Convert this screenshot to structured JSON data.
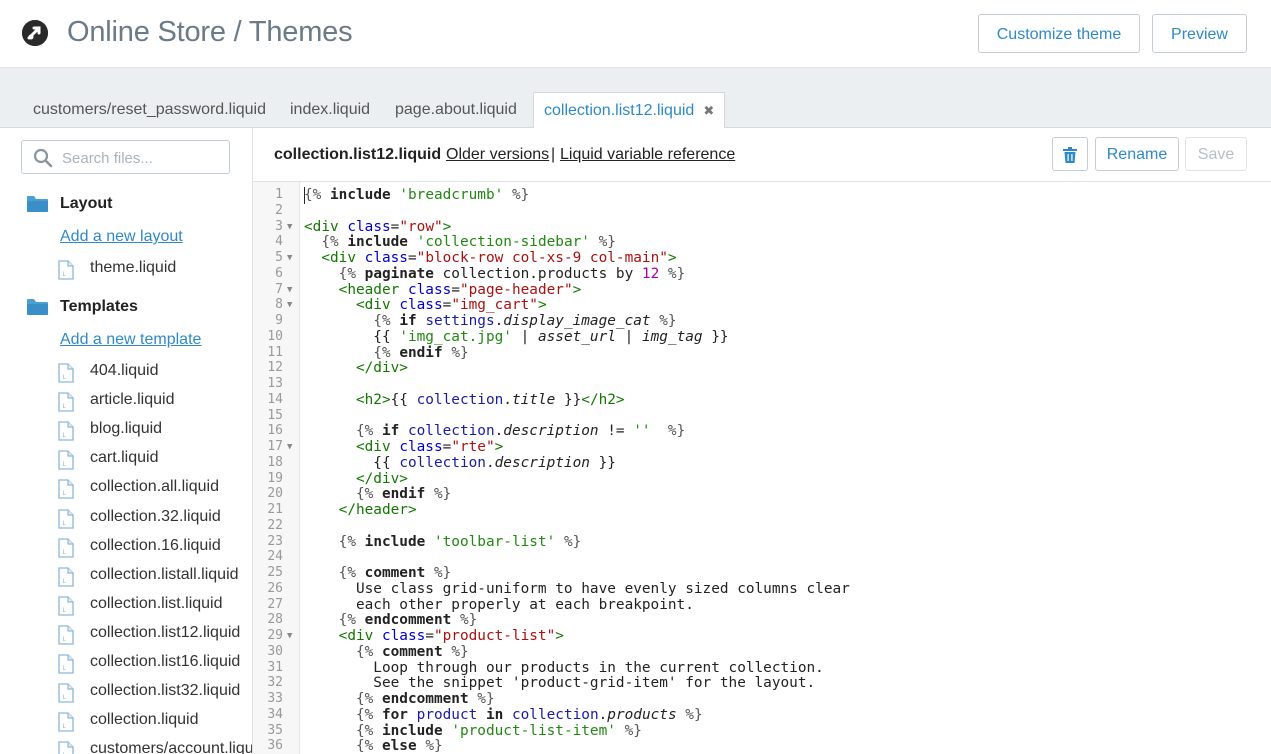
{
  "header": {
    "title": "Online Store / Themes",
    "customize_label": "Customize theme",
    "preview_label": "Preview"
  },
  "tabs": [
    {
      "label": "customers/reset_password.liquid",
      "active": false
    },
    {
      "label": "index.liquid",
      "active": false
    },
    {
      "label": "page.about.liquid",
      "active": false
    },
    {
      "label": "collection.list12.liquid",
      "active": true
    }
  ],
  "sidebar": {
    "search_placeholder": "Search files...",
    "layout_heading": "Layout",
    "add_layout_label": "Add a new layout",
    "layout_files": [
      "theme.liquid"
    ],
    "templates_heading": "Templates",
    "add_template_label": "Add a new template",
    "template_files": [
      "404.liquid",
      "article.liquid",
      "blog.liquid",
      "cart.liquid",
      "collection.all.liquid",
      "collection.32.liquid",
      "collection.16.liquid",
      "collection.listall.liquid",
      "collection.list.liquid",
      "collection.list12.liquid",
      "collection.list16.liquid",
      "collection.list32.liquid",
      "collection.liquid",
      "customers/account.liquid"
    ]
  },
  "editor": {
    "file_name": "collection.list12.liquid",
    "older_versions_label": "Older versions",
    "separator": "|",
    "variable_reference_label": "Liquid variable reference",
    "rename_label": "Rename",
    "save_label": "Save"
  },
  "colors": {
    "accent": "#2e8ac7",
    "tag": "#117700",
    "string": "#228811",
    "attr": "#0000cc",
    "variable": "#1a1aa6",
    "number": "#aa00aa"
  },
  "code_lines": [
    {
      "n": "1",
      "fold": false,
      "segs": [
        [
          "delim",
          "{% "
        ],
        [
          "kw",
          "include"
        ],
        [
          "p",
          " "
        ],
        [
          "str",
          "'breadcrumb'"
        ],
        [
          "p",
          " "
        ],
        [
          "delim",
          "%}"
        ]
      ]
    },
    {
      "n": "2",
      "fold": false,
      "segs": []
    },
    {
      "n": "3",
      "fold": true,
      "segs": [
        [
          "tag",
          "<div"
        ],
        [
          "p",
          " "
        ],
        [
          "attr",
          "class"
        ],
        [
          "p",
          "="
        ],
        [
          "aval",
          "\"row\""
        ],
        [
          "tag",
          ">"
        ]
      ]
    },
    {
      "n": "4",
      "fold": false,
      "segs": [
        [
          "p",
          "  "
        ],
        [
          "delim",
          "{% "
        ],
        [
          "kw",
          "include"
        ],
        [
          "p",
          " "
        ],
        [
          "str",
          "'collection-sidebar'"
        ],
        [
          "p",
          " "
        ],
        [
          "delim",
          "%}"
        ]
      ]
    },
    {
      "n": "5",
      "fold": true,
      "segs": [
        [
          "p",
          "  "
        ],
        [
          "tag",
          "<div"
        ],
        [
          "p",
          " "
        ],
        [
          "attr",
          "class"
        ],
        [
          "p",
          "="
        ],
        [
          "aval",
          "\"block-row col-xs-9 col-main\""
        ],
        [
          "tag",
          ">"
        ]
      ]
    },
    {
      "n": "6",
      "fold": false,
      "segs": [
        [
          "p",
          "    "
        ],
        [
          "delim",
          "{% "
        ],
        [
          "kw",
          "paginate"
        ],
        [
          "p",
          " collection.products by "
        ],
        [
          "num",
          "12"
        ],
        [
          "p",
          " "
        ],
        [
          "delim",
          "%}"
        ]
      ]
    },
    {
      "n": "7",
      "fold": true,
      "segs": [
        [
          "p",
          "    "
        ],
        [
          "tag",
          "<header"
        ],
        [
          "p",
          " "
        ],
        [
          "attr",
          "class"
        ],
        [
          "p",
          "="
        ],
        [
          "aval",
          "\"page-header\""
        ],
        [
          "tag",
          ">"
        ]
      ]
    },
    {
      "n": "8",
      "fold": true,
      "segs": [
        [
          "p",
          "      "
        ],
        [
          "tag",
          "<div"
        ],
        [
          "p",
          " "
        ],
        [
          "attr",
          "class"
        ],
        [
          "p",
          "="
        ],
        [
          "aval",
          "\"img_cart\""
        ],
        [
          "tag",
          ">"
        ]
      ]
    },
    {
      "n": "9",
      "fold": false,
      "segs": [
        [
          "p",
          "        "
        ],
        [
          "delim",
          "{% "
        ],
        [
          "kw",
          "if"
        ],
        [
          "p",
          " "
        ],
        [
          "var",
          "settings"
        ],
        [
          "p",
          "."
        ],
        [
          "prop",
          "display_image_cat"
        ],
        [
          "p",
          " "
        ],
        [
          "delim",
          "%}"
        ]
      ]
    },
    {
      "n": "10",
      "fold": false,
      "segs": [
        [
          "p",
          "        {{ "
        ],
        [
          "str",
          "'img_cat.jpg'"
        ],
        [
          "p",
          " | "
        ],
        [
          "prop",
          "asset_url"
        ],
        [
          "p",
          " | "
        ],
        [
          "prop",
          "img_tag"
        ],
        [
          "p",
          " }}"
        ]
      ]
    },
    {
      "n": "11",
      "fold": false,
      "segs": [
        [
          "p",
          "        "
        ],
        [
          "delim",
          "{% "
        ],
        [
          "kw",
          "endif"
        ],
        [
          "p",
          " "
        ],
        [
          "delim",
          "%}"
        ]
      ]
    },
    {
      "n": "12",
      "fold": false,
      "segs": [
        [
          "p",
          "      "
        ],
        [
          "tag",
          "</div>"
        ]
      ]
    },
    {
      "n": "13",
      "fold": false,
      "segs": []
    },
    {
      "n": "14",
      "fold": false,
      "segs": [
        [
          "p",
          "      "
        ],
        [
          "tag",
          "<h2>"
        ],
        [
          "p",
          "{{ "
        ],
        [
          "var",
          "collection"
        ],
        [
          "p",
          "."
        ],
        [
          "prop",
          "title"
        ],
        [
          "p",
          " }}"
        ],
        [
          "tag",
          "</h2>"
        ]
      ]
    },
    {
      "n": "15",
      "fold": false,
      "segs": []
    },
    {
      "n": "16",
      "fold": false,
      "segs": [
        [
          "p",
          "      "
        ],
        [
          "delim",
          "{% "
        ],
        [
          "kw",
          "if"
        ],
        [
          "p",
          " "
        ],
        [
          "var",
          "collection"
        ],
        [
          "p",
          "."
        ],
        [
          "prop",
          "description"
        ],
        [
          "p",
          " != "
        ],
        [
          "str",
          "''"
        ],
        [
          "p",
          "  "
        ],
        [
          "delim",
          "%}"
        ]
      ]
    },
    {
      "n": "17",
      "fold": true,
      "segs": [
        [
          "p",
          "      "
        ],
        [
          "tag",
          "<div"
        ],
        [
          "p",
          " "
        ],
        [
          "attr",
          "class"
        ],
        [
          "p",
          "="
        ],
        [
          "aval",
          "\"rte\""
        ],
        [
          "tag",
          ">"
        ]
      ]
    },
    {
      "n": "18",
      "fold": false,
      "segs": [
        [
          "p",
          "        {{ "
        ],
        [
          "var",
          "collection"
        ],
        [
          "p",
          "."
        ],
        [
          "prop",
          "description"
        ],
        [
          "p",
          " }}"
        ]
      ]
    },
    {
      "n": "19",
      "fold": false,
      "segs": [
        [
          "p",
          "      "
        ],
        [
          "tag",
          "</div>"
        ]
      ]
    },
    {
      "n": "20",
      "fold": false,
      "segs": [
        [
          "p",
          "      "
        ],
        [
          "delim",
          "{% "
        ],
        [
          "kw",
          "endif"
        ],
        [
          "p",
          " "
        ],
        [
          "delim",
          "%}"
        ]
      ]
    },
    {
      "n": "21",
      "fold": false,
      "segs": [
        [
          "p",
          "    "
        ],
        [
          "tag",
          "</header>"
        ]
      ]
    },
    {
      "n": "22",
      "fold": false,
      "segs": []
    },
    {
      "n": "23",
      "fold": false,
      "segs": [
        [
          "p",
          "    "
        ],
        [
          "delim",
          "{% "
        ],
        [
          "kw",
          "include"
        ],
        [
          "p",
          " "
        ],
        [
          "str",
          "'toolbar-list'"
        ],
        [
          "p",
          " "
        ],
        [
          "delim",
          "%}"
        ]
      ]
    },
    {
      "n": "24",
      "fold": false,
      "segs": []
    },
    {
      "n": "25",
      "fold": false,
      "segs": [
        [
          "p",
          "    "
        ],
        [
          "delim",
          "{% "
        ],
        [
          "kw",
          "comment"
        ],
        [
          "p",
          " "
        ],
        [
          "delim",
          "%}"
        ]
      ]
    },
    {
      "n": "26",
      "fold": false,
      "segs": [
        [
          "p",
          "      Use class grid-uniform to have evenly sized columns clear"
        ]
      ]
    },
    {
      "n": "27",
      "fold": false,
      "segs": [
        [
          "p",
          "      each other properly at each breakpoint."
        ]
      ]
    },
    {
      "n": "28",
      "fold": false,
      "segs": [
        [
          "p",
          "    "
        ],
        [
          "delim",
          "{% "
        ],
        [
          "kw",
          "endcomment"
        ],
        [
          "p",
          " "
        ],
        [
          "delim",
          "%}"
        ]
      ]
    },
    {
      "n": "29",
      "fold": true,
      "segs": [
        [
          "p",
          "    "
        ],
        [
          "tag",
          "<div"
        ],
        [
          "p",
          " "
        ],
        [
          "attr",
          "class"
        ],
        [
          "p",
          "="
        ],
        [
          "aval",
          "\"product-list\""
        ],
        [
          "tag",
          ">"
        ]
      ]
    },
    {
      "n": "30",
      "fold": false,
      "segs": [
        [
          "p",
          "      "
        ],
        [
          "delim",
          "{% "
        ],
        [
          "kw",
          "comment"
        ],
        [
          "p",
          " "
        ],
        [
          "delim",
          "%}"
        ]
      ]
    },
    {
      "n": "31",
      "fold": false,
      "segs": [
        [
          "p",
          "        Loop through our products in the current collection."
        ]
      ]
    },
    {
      "n": "32",
      "fold": false,
      "segs": [
        [
          "p",
          "        See the snippet 'product-grid-item' for the layout."
        ]
      ]
    },
    {
      "n": "33",
      "fold": false,
      "segs": [
        [
          "p",
          "      "
        ],
        [
          "delim",
          "{% "
        ],
        [
          "kw",
          "endcomment"
        ],
        [
          "p",
          " "
        ],
        [
          "delim",
          "%}"
        ]
      ]
    },
    {
      "n": "34",
      "fold": false,
      "segs": [
        [
          "p",
          "      "
        ],
        [
          "delim",
          "{% "
        ],
        [
          "kw",
          "for"
        ],
        [
          "p",
          " "
        ],
        [
          "var",
          "product"
        ],
        [
          "p",
          " "
        ],
        [
          "kw",
          "in"
        ],
        [
          "p",
          " "
        ],
        [
          "var",
          "collection"
        ],
        [
          "p",
          "."
        ],
        [
          "prop",
          "products"
        ],
        [
          "p",
          " "
        ],
        [
          "delim",
          "%}"
        ]
      ]
    },
    {
      "n": "35",
      "fold": false,
      "segs": [
        [
          "p",
          "      "
        ],
        [
          "delim",
          "{% "
        ],
        [
          "kw",
          "include"
        ],
        [
          "p",
          " "
        ],
        [
          "str",
          "'product-list-item'"
        ],
        [
          "p",
          " "
        ],
        [
          "delim",
          "%}"
        ]
      ]
    },
    {
      "n": "36",
      "fold": false,
      "segs": [
        [
          "p",
          "      "
        ],
        [
          "delim",
          "{% "
        ],
        [
          "kw",
          "else"
        ],
        [
          "p",
          " "
        ],
        [
          "delim",
          "%}"
        ]
      ]
    }
  ]
}
